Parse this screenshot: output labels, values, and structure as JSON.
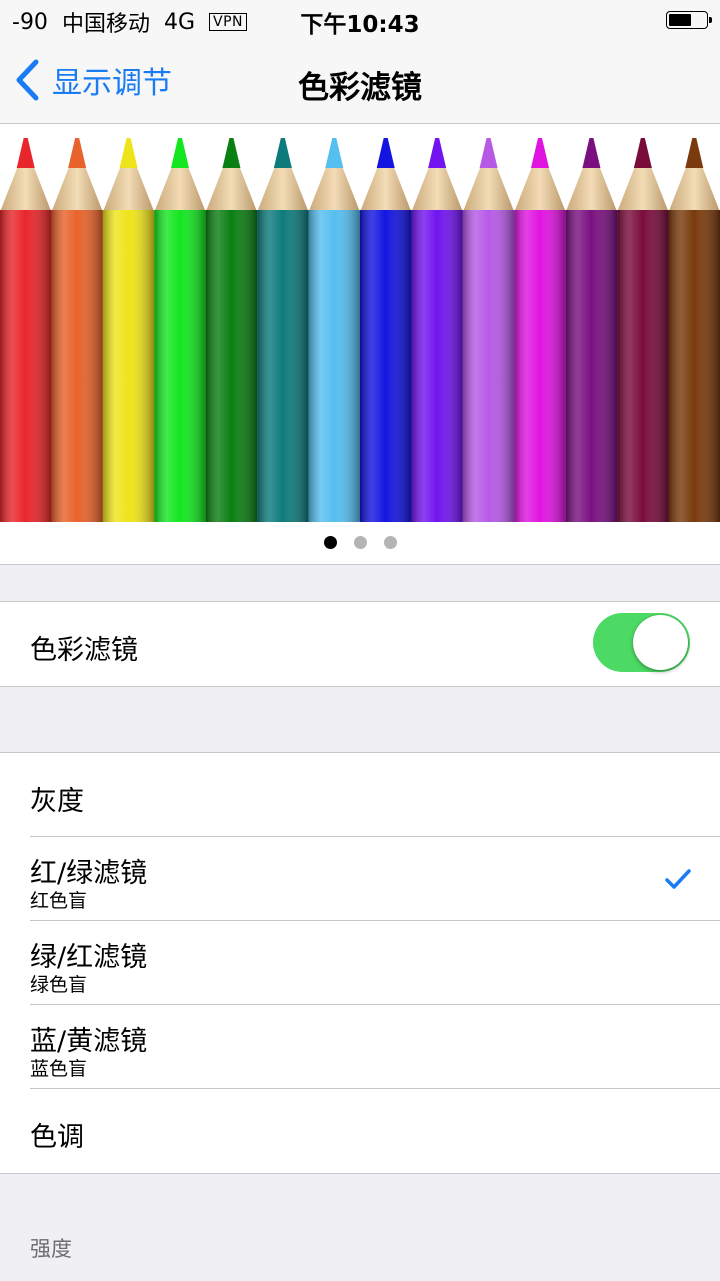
{
  "status_bar": {
    "signal": "-90",
    "carrier": "中国移动",
    "network": "4G",
    "vpn": "VPN",
    "time": "下午10:43"
  },
  "nav": {
    "back_label": "显示调节",
    "title": "色彩滤镜"
  },
  "banner": {
    "pencil_colors": [
      "#e8262b",
      "#e8622b",
      "#efe41a",
      "#14e620",
      "#0a7f12",
      "#0d7b7b",
      "#55bff0",
      "#1414e0",
      "#7214f0",
      "#b65ae6",
      "#e014e0",
      "#7a1080",
      "#7a0c3c",
      "#7a3a0c"
    ],
    "page_count": 3,
    "current_page": 1
  },
  "filter_toggle": {
    "label": "色彩滤镜",
    "on": true
  },
  "filters": [
    {
      "title": "灰度",
      "subtitle": "",
      "selected": false
    },
    {
      "title": "红/绿滤镜",
      "subtitle": "红色盲",
      "selected": true
    },
    {
      "title": "绿/红滤镜",
      "subtitle": "绿色盲",
      "selected": false
    },
    {
      "title": "蓝/黄滤镜",
      "subtitle": "蓝色盲",
      "selected": false
    },
    {
      "title": "色调",
      "subtitle": "",
      "selected": false
    }
  ],
  "section_footer": "强度",
  "colors": {
    "accent": "#1a7cf5",
    "toggle_on": "#4cd964"
  }
}
